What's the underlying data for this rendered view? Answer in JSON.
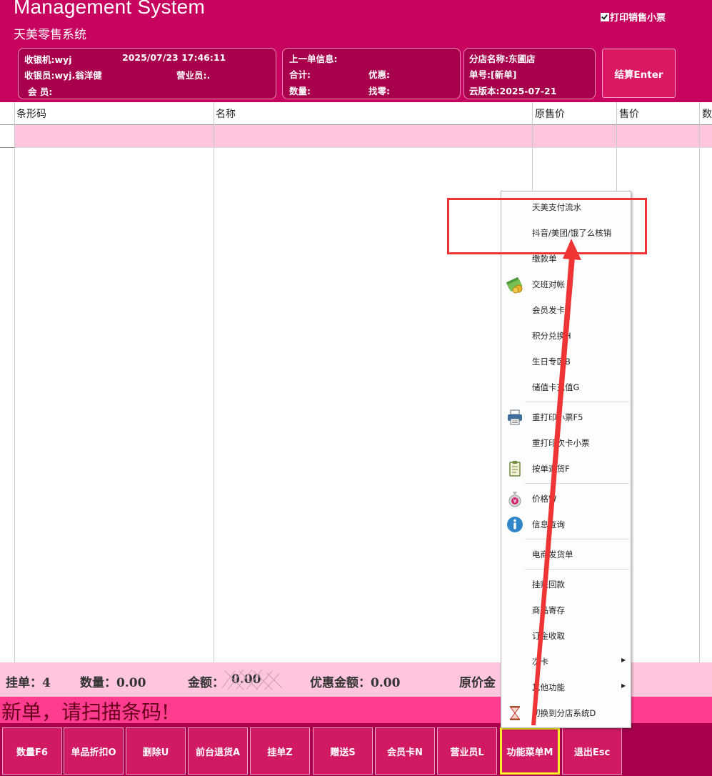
{
  "header": {
    "title": "Management System",
    "subtitle": "天美零售系统",
    "print_receipt_label": "打印销售小票"
  },
  "cashier_box": {
    "register": "收银机:wyj",
    "datetime": "2025/07/23 17:46:11",
    "cashier": "收银员:wyj.翁洋健",
    "salesperson": "营业员:.",
    "member": "会 员:"
  },
  "last_order_box": {
    "title": "上一单信息:",
    "total": "合计:",
    "discount": "优惠:",
    "quantity": "数量:",
    "change": "找零:"
  },
  "store_box": {
    "store": "分店名称:东圃店",
    "order_no": "单号:[新单]",
    "cloud_version": "云版本:2025-07-21"
  },
  "settle_button": "结算Enter",
  "grid": {
    "columns": [
      "条形码",
      "名称",
      "原售价",
      "售价",
      "数"
    ]
  },
  "status": {
    "pending": "挂单：4",
    "quantity": "数量：0.00",
    "amount_label": "金额：",
    "amount_value": "0.00",
    "discount_amount": "优惠金额：0.00",
    "original_price": "原价金"
  },
  "scan_prompt": "新单，请扫描条码!",
  "footer_buttons": [
    {
      "label": "数量F6"
    },
    {
      "label": "单品折扣O"
    },
    {
      "label": "删除U"
    },
    {
      "label": "前台退货A"
    },
    {
      "label": "挂单Z"
    },
    {
      "label": "赠送S"
    },
    {
      "label": "会员卡N"
    },
    {
      "label": "营业员L"
    },
    {
      "label": "功能菜单M"
    },
    {
      "label": "退出Esc"
    }
  ],
  "menu": {
    "items": [
      {
        "label": "天美支付流水"
      },
      {
        "label": "抖音/美团/饿了么核销"
      },
      {
        "label": "缴款单"
      },
      {
        "label": "交班对帐",
        "icon": "money-coins-icon"
      },
      {
        "label": "会员发卡V"
      },
      {
        "label": "积分兑换H"
      },
      {
        "label": "生日专区B"
      },
      {
        "label": "储值卡充值G"
      },
      {
        "label": "重打印小票F5",
        "icon": "printer-icon"
      },
      {
        "label": "重打印次卡小票"
      },
      {
        "label": "按单退货F",
        "icon": "clipboard-icon"
      },
      {
        "label": "价格W",
        "icon": "money-bag-icon"
      },
      {
        "label": "信息查询",
        "icon": "info-icon"
      },
      {
        "label": "电商发货单"
      },
      {
        "label": "挂账回款"
      },
      {
        "label": "商品寄存"
      },
      {
        "label": "订金收取"
      },
      {
        "label": "次卡"
      },
      {
        "label": "其他功能"
      },
      {
        "label": "切换到分店系统D",
        "icon": "hourglass-icon"
      }
    ]
  },
  "colors": {
    "brand": "#c8025f",
    "panel": "#a8004c",
    "row_highlight": "#ffc6de",
    "scan_bar": "#ff3c8e",
    "annotation": "#ee3434",
    "active_button_border": "#ffef2b"
  }
}
